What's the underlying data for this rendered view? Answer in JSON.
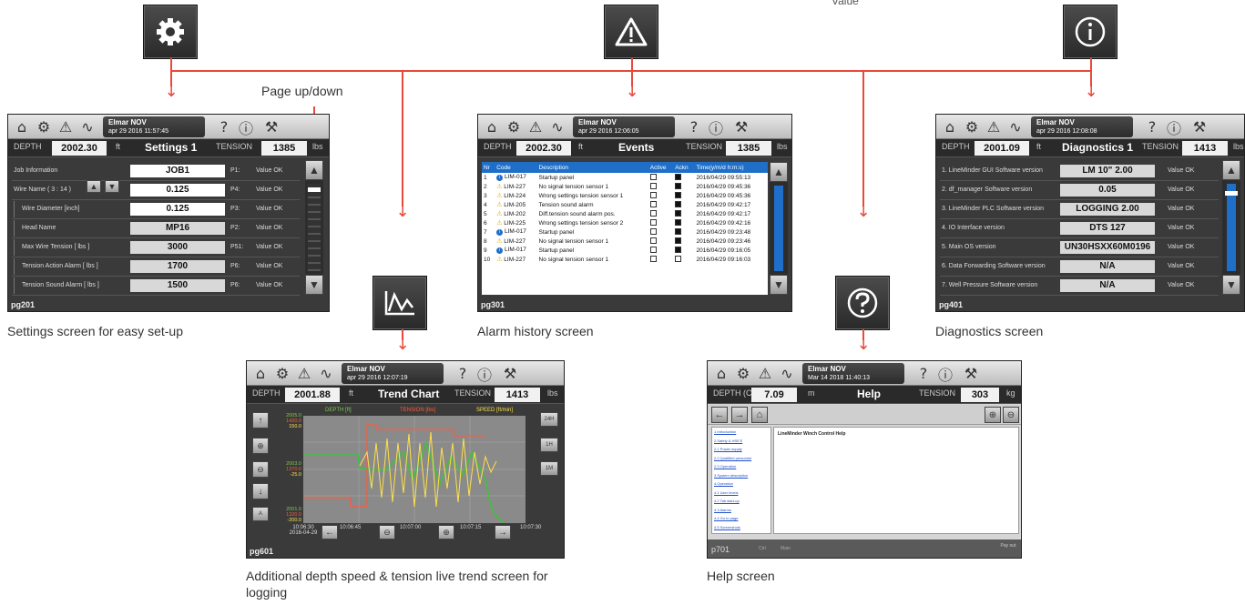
{
  "top_label_fragment": "Value",
  "icons": {
    "settings": "gear-icon",
    "alarm": "warning-icon",
    "info": "info-icon",
    "trend": "trend-icon",
    "help": "help-icon"
  },
  "page_updown_label": "Page up/down",
  "captions": {
    "settings": "Settings screen for easy set-up",
    "alarm": "Alarm history screen",
    "diagnostics": "Diagnostics screen",
    "trend": "Additional depth speed & tension live trend screen for logging",
    "help": "Help screen"
  },
  "colors": {
    "accent": "#e8493a",
    "screen_bg": "#3a3a3a",
    "table_header": "#1f6fc9",
    "chart_bg": "#8a8a8a"
  },
  "settings_screen": {
    "logo": "Elmar NOV",
    "date": "apr 29 2016",
    "time": "11:57:45",
    "depth_label": "DEPTH",
    "depth": "2002.30",
    "depth_unit": "ft",
    "title": "Settings 1",
    "tension_label": "TENSION",
    "tension": "1385",
    "tension_unit": "lbs",
    "rows": [
      {
        "label": "Job Information",
        "value": "JOB1",
        "p": "P1:",
        "status": "Value OK"
      },
      {
        "label": "Wire Name  ( 3 : 14 )",
        "value": "0.125",
        "p": "P4:",
        "status": "Value OK"
      },
      {
        "label": "Wire Diameter [inch]",
        "value": "0.125",
        "p": "P3:",
        "status": "Value OK"
      },
      {
        "label": "Head Name",
        "value": "MP16",
        "p": "P2:",
        "status": "Value OK"
      },
      {
        "label": "Max Wire Tension [ lbs ]",
        "value": "3000",
        "p": "P51:",
        "status": "Value OK"
      },
      {
        "label": "Tension Action Alarm [ lbs ]",
        "value": "1700",
        "p": "P6:",
        "status": "Value OK"
      },
      {
        "label": "Tension Sound Alarm [ lbs ]",
        "value": "1500",
        "p": "P6:",
        "status": "Value OK"
      }
    ],
    "page": "pg201"
  },
  "events_screen": {
    "logo": "Elmar NOV",
    "date": "apr 29 2016",
    "time": "12:06:05",
    "depth_label": "DEPTH",
    "depth": "2002.30",
    "depth_unit": "ft",
    "title": "Events",
    "tension_label": "TENSION",
    "tension": "1385",
    "tension_unit": "lbs",
    "headers": [
      "Nr",
      "Code",
      "Description",
      "Active",
      "Ackn",
      "Time(y/m/d h:m:s)"
    ],
    "rows": [
      {
        "nr": "1",
        "type": "info",
        "code": "LIM-017",
        "desc": "Startup panel",
        "ackn": true,
        "time": "2016/04/29  09:55:13"
      },
      {
        "nr": "2",
        "type": "warn",
        "code": "LIM-227",
        "desc": "No signal tension sensor 1",
        "ackn": true,
        "time": "2016/04/29  09:45:36"
      },
      {
        "nr": "3",
        "type": "warn",
        "code": "LIM-224",
        "desc": "Wrong settings tension sensor 1",
        "ackn": true,
        "time": "2016/04/29  09:45:36"
      },
      {
        "nr": "4",
        "type": "warn",
        "code": "LIM-205",
        "desc": "Tension sound alarm",
        "ackn": true,
        "time": "2016/04/29  09:42:17"
      },
      {
        "nr": "5",
        "type": "warn",
        "code": "LIM-202",
        "desc": "Diff.tension sound alarm pos.",
        "ackn": true,
        "time": "2016/04/29  09:42:17"
      },
      {
        "nr": "6",
        "type": "warn",
        "code": "LIM-225",
        "desc": "Wrong settings tension sensor 2",
        "ackn": true,
        "time": "2016/04/29  09:42:16"
      },
      {
        "nr": "7",
        "type": "info",
        "code": "LIM-017",
        "desc": "Startup panel",
        "ackn": true,
        "time": "2016/04/29  09:23:48"
      },
      {
        "nr": "8",
        "type": "warn",
        "code": "LIM-227",
        "desc": "No signal tension sensor 1",
        "ackn": true,
        "time": "2016/04/29  09:23:46"
      },
      {
        "nr": "9",
        "type": "info",
        "code": "LIM-017",
        "desc": "Startup panel",
        "ackn": true,
        "time": "2016/04/29  09:16:05"
      },
      {
        "nr": "10",
        "type": "warn",
        "code": "LIM-227",
        "desc": "No signal tension sensor 1",
        "ackn": false,
        "time": "2016/04/29  09:16:03"
      }
    ],
    "page": "pg301"
  },
  "diag_screen": {
    "logo": "Elmar NOV",
    "date": "apr 29 2016",
    "time": "12:08:08",
    "depth_label": "DEPTH",
    "depth": "2001.09",
    "depth_unit": "ft",
    "title": "Diagnostics 1",
    "tension_label": "TENSION",
    "tension": "1413",
    "tension_unit": "lbs",
    "rows": [
      {
        "label": "1. LineMinder GUI Software version",
        "value": "LM 10\" 2.00",
        "status": "Value OK"
      },
      {
        "label": "2. df_manager Software version",
        "value": "0.05",
        "status": "Value OK"
      },
      {
        "label": "3. LineMinder PLC Software version",
        "value": "LOGGING 2.00",
        "status": "Value OK"
      },
      {
        "label": "4. IO Interface version",
        "value": "DTS 127",
        "status": "Value OK"
      },
      {
        "label": "5. Main OS version",
        "value": "UN30HSXX60M0196",
        "status": "Value OK"
      },
      {
        "label": "6. Data Forwarding Software version",
        "value": "N/A",
        "status": "Value OK"
      },
      {
        "label": "7. Well Pressure Software version",
        "value": "N/A",
        "status": "Value OK"
      }
    ],
    "page": "pg401"
  },
  "trend_screen": {
    "logo": "Elmar NOV",
    "date": "apr 29 2016",
    "time": "12:07:19",
    "depth_label": "DEPTH",
    "depth": "2001.88",
    "depth_unit": "ft",
    "title": "Trend Chart",
    "tension_label": "TENSION",
    "tension": "1413",
    "tension_unit": "lbs",
    "legend": [
      "DEPTH [ft]",
      "TENSION [lbs]",
      "SPEED [ft/min]"
    ],
    "yticks_top": [
      "2005.0",
      "1420.0",
      "150.0"
    ],
    "yticks_mid": [
      "2003.0",
      "1370.0",
      "-25.0"
    ],
    "yticks_bot": [
      "2001.0",
      "1320.0",
      "-200.0"
    ],
    "xticks": [
      "10:06:30",
      "10:06:45",
      "10:07:00",
      "10:07:15",
      "10:07:30"
    ],
    "xdate": "2016-04-29",
    "side_buttons": [
      "24H",
      "1H",
      "1M"
    ],
    "page": "pg601"
  },
  "help_screen": {
    "logo": "Elmar NOV",
    "date": "Mar 14 2018",
    "time": "11:40:13",
    "depth_label": "DEPTH (C)",
    "depth": "7.09",
    "depth_unit": "m",
    "title": "Help",
    "tension_label": "TENSION",
    "tension": "303",
    "tension_unit": "kg",
    "heading": "LineMinder Winch Control Help",
    "toc": [
      "1.Introduction",
      "2.Safety & HSE'S",
      "2.1 Power supply",
      "2.2 Qualified personnel",
      "2.3 Operation",
      "3.System description",
      "4.Operation",
      "4.1 User levels",
      "4.2 Tab start-up",
      "4.3 Alarms",
      "4.4 Go to page",
      "4.5 Screenshots"
    ],
    "bottom_left": "p701",
    "bottom_right": "Pay out",
    "footer_items": [
      "Ctrl",
      "Main"
    ]
  }
}
